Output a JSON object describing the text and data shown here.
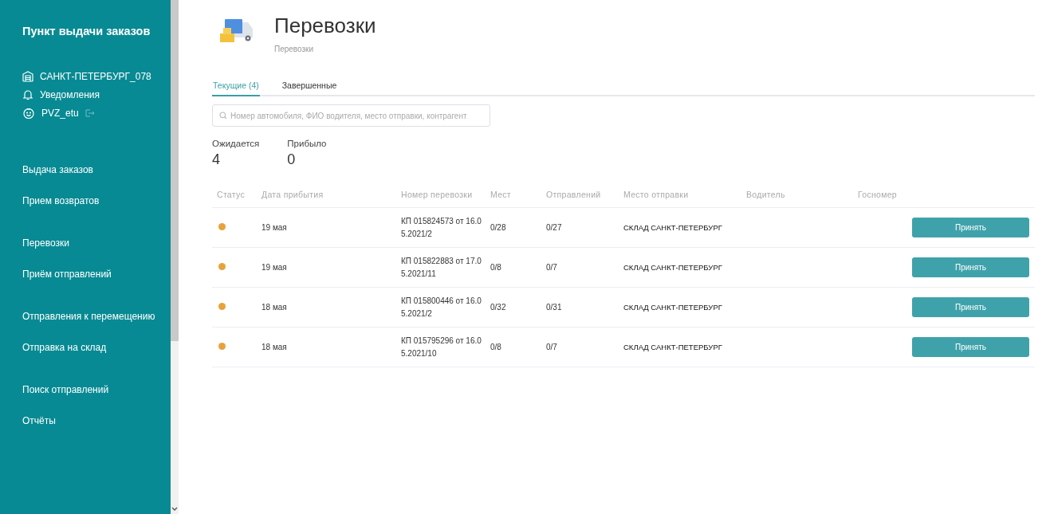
{
  "sidebar": {
    "title": "Пункт выдачи заказов",
    "account": [
      {
        "kind": "store",
        "label": "САНКТ-ПЕТЕРБУРГ_078"
      },
      {
        "kind": "bell",
        "label": "Уведомления"
      },
      {
        "kind": "user",
        "label": "PVZ_etu"
      }
    ],
    "nav_groups": [
      [
        "Выдача заказов",
        "Прием возвратов"
      ],
      [
        "Перевозки",
        "Приём отправлений"
      ],
      [
        "Отправления к перемещению",
        "Отправка на склад"
      ],
      [
        "Поиск отправлений",
        "Отчёты"
      ]
    ]
  },
  "header": {
    "title": "Перевозки",
    "breadcrumb": "Перевозки"
  },
  "tabs": [
    {
      "label": "Текущие (4)",
      "selected": true
    },
    {
      "label": "Завершенные",
      "selected": false
    }
  ],
  "search": {
    "placeholder": "Номер автомобиля, ФИО водителя, место отправки, контрагент"
  },
  "stats": [
    {
      "label": "Ожидается",
      "value": "4"
    },
    {
      "label": "Прибыло",
      "value": "0"
    }
  ],
  "table": {
    "columns": [
      "Статус",
      "Дата прибытия",
      "Номер перевозки",
      "Мест",
      "Отправлений",
      "Место отправки",
      "Водитель",
      "Госномер"
    ],
    "rows": [
      {
        "color": "#e6a23c",
        "date": "19 мая",
        "number": "КП 015824573 от 16.05.2021/2",
        "places": "0/28",
        "shipments": "0/27",
        "origin": "СКЛАД САНКТ-ПЕТЕРБУРГ",
        "action": "Принять"
      },
      {
        "color": "#e6a23c",
        "date": "19 мая",
        "number": "КП 015822883 от 17.05.2021/11",
        "places": "0/8",
        "shipments": "0/7",
        "origin": "СКЛАД САНКТ-ПЕТЕРБУРГ",
        "action": "Принять"
      },
      {
        "color": "#e6a23c",
        "date": "18 мая",
        "number": "КП 015800446 от 16.05.2021/2",
        "places": "0/32",
        "shipments": "0/31",
        "origin": "СКЛАД САНКТ-ПЕТЕРБУРГ",
        "action": "Принять"
      },
      {
        "color": "#e6a23c",
        "date": "18 мая",
        "number": "КП 015795296 от 16.05.2021/10",
        "places": "0/8",
        "shipments": "0/7",
        "origin": "СКЛАД САНКТ-ПЕТЕРБУРГ",
        "action": "Принять"
      }
    ]
  }
}
